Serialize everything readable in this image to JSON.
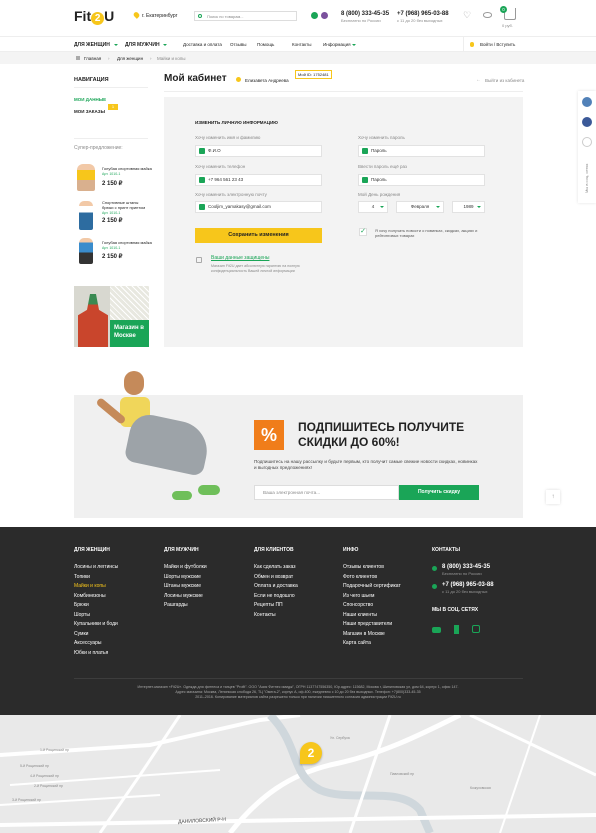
{
  "header": {
    "logo_a": "Fit",
    "logo_b": "2",
    "logo_c": "U",
    "city": "г. Екатеринбург",
    "search_placeholder": "Поиск по товарам...",
    "phone1": "8 (800) 333-45-35",
    "phone1_note": "Бесплатно по России",
    "phone2": "+7 (968) 965-03-88",
    "phone2_note": "с 11 до 20 без выходных",
    "cart_count": "0",
    "cart_sum": "0 руб."
  },
  "nav": {
    "women": "ДЛЯ ЖЕНЩИН",
    "men": "ДЛЯ МУЖЧИН",
    "links": [
      "Доставка и оплата",
      "Отзывы",
      "Помощь",
      "Контакты",
      "Информация"
    ],
    "login": "Войти / Вступить"
  },
  "breadcrumb": [
    "Главная",
    "Для женщин",
    "Майки и копы"
  ],
  "sidebar": {
    "title": "НАВИГАЦИЯ",
    "items": [
      "МОИ ДАННЫЕ",
      "МОИ ЗАКАЗЫ"
    ],
    "orders_badge": "1",
    "offer_title": "Супер-предложение:",
    "products": [
      {
        "name": "Голубая спортивная майка",
        "sku": "Арт. 1010-1",
        "price": "2 150 ₽"
      },
      {
        "name": "Спортивные штаны брюки с принт принтом",
        "sku": "Арт. 1010-1",
        "price": "2 150 ₽"
      },
      {
        "name": "Голубая спортивная майка",
        "sku": "Арт. 1010-1",
        "price": "2 150 ₽"
      }
    ],
    "store_label": "Магазин в Москве"
  },
  "cabinet": {
    "title": "Мой кабинет",
    "user": "Елизавета Андреева",
    "badge": "Мой ID: 1752481",
    "back": "Выйти из кабинета",
    "form_title": "ИЗМЕНИТЬ ЛИЧНУЮ ИНФОРМАЦИЮ",
    "name_label": "Хочу изменить имя и фамилию",
    "name_value": "Ф.И.О",
    "phone_label": "Хочу изменить телефон",
    "phone_value": "+7 964 561 23 43",
    "email_label": "Хочу изменить электронную почту",
    "email_value": "Cooljim_yamakasy@gmail.com",
    "pass_label": "Хочу изменить пароль",
    "pass_value": "Пароль",
    "pass2_label": "Ввести пароль ещё раз",
    "pass2_value": "Пароль",
    "bday_label": "Мой День рождения",
    "day": "4",
    "month": "Февраля",
    "year": "1989",
    "news": "Я хочу получать новости о новинках, скидках, акциях и рейтинговых товарах",
    "save": "Сохранить изменения",
    "secure_title": "Ваши данные защищены",
    "secure_text": "Магазин Fit2U дает абсолютную гарантию на полную конфиденциальность Вашей личной информации"
  },
  "promo": {
    "percent": "%",
    "title1": "ПОДПИШИТЕСЬ ПОЛУЧИТЕ",
    "title2": "СКИДКИ ДО 60%!",
    "text": "Подпишитесь на нашу рассылку и будьте первым, кто получит самые свежие новости скидках, новинках и выгодных предложениях!",
    "placeholder": "Ваша электронная почта...",
    "button": "Получить скидку"
  },
  "social": {
    "sidebar_label": "Мы в соц. сетях"
  },
  "footer": {
    "cols": [
      {
        "title": "ДЛЯ ЖЕНЩИН",
        "items": [
          "Лосины и леггинсы",
          "Топики",
          "Майки и копы",
          "Комбинезоны",
          "Брюки",
          "Шорты",
          "Купальники и боди",
          "Сумки",
          "Аксессуары",
          "Юбки и платья"
        ]
      },
      {
        "title": "ДЛЯ МУЖЧИН",
        "items": [
          "Майки и футболки",
          "Шорты мужские",
          "Штаны мужские",
          "Лосины мужские",
          "Рашгарды"
        ]
      },
      {
        "title": "ДЛЯ КЛИЕНТОВ",
        "items": [
          "Как сделать заказ",
          "Обмен и возврат",
          "Оплата и доставка",
          "Если не подошло",
          "Рецепты ПП",
          "Контакты"
        ]
      },
      {
        "title": "ИНФО",
        "items": [
          "Отзывы клиентов",
          "Фото клиентов",
          "Подарочный сертификат",
          "Из чего шьем",
          "Спонсорство",
          "Наши клиенты",
          "Наши представители",
          "Магазин в Москве",
          "Карта сайта"
        ]
      }
    ],
    "contacts_title": "КОНТАКТЫ",
    "phone1": "8 (800) 333-45-35",
    "phone1_note": "Бесплатно по России",
    "phone2": "+7 (968) 965-03-88",
    "phone2_note": "с 11 до 20 без выходных",
    "social_title": "МЫ В СОЦ. СЕТЯХ",
    "legal1": "Интернет-магазин «Fit2U». Одежда для фитнеса и танцев \"Profit\". ООО \"Асия Фитнес имидж\", ОГРН 1137747556350, Юр.адрес: 115682, Москва г, Шипиловская ул, дом 64, корпус 1, офис 147.",
    "legal2": "Адрес магазина: Москва, Ленинская слобода 26, ТЦ \"Омега-2\", корпус А, оф.400, ежедневно с 10 до 20 без выходных. Телефон: +7(800)333-45-35",
    "legal3": "2011–2016. Копирование материалов сайта разрешено только при наличии письменного согласия администрации Fit2U.ru"
  },
  "map": {
    "street": "ДАНИЛОВСКИЙ Р-Н",
    "pin": "2",
    "labels": [
      "1-й Рощинский пр",
      "5-й Рощинский пр",
      "4-й Рощинский пр",
      "2-й Рощинский пр",
      "3-й Рощинский пр",
      "Ул. Сербуха",
      "Павловский пр",
      "Кожуховская"
    ]
  },
  "colors": {
    "green": "#1aa557",
    "yellow": "#f7c61b",
    "orange": "#f07d1a",
    "dark": "#2b2b2b"
  }
}
